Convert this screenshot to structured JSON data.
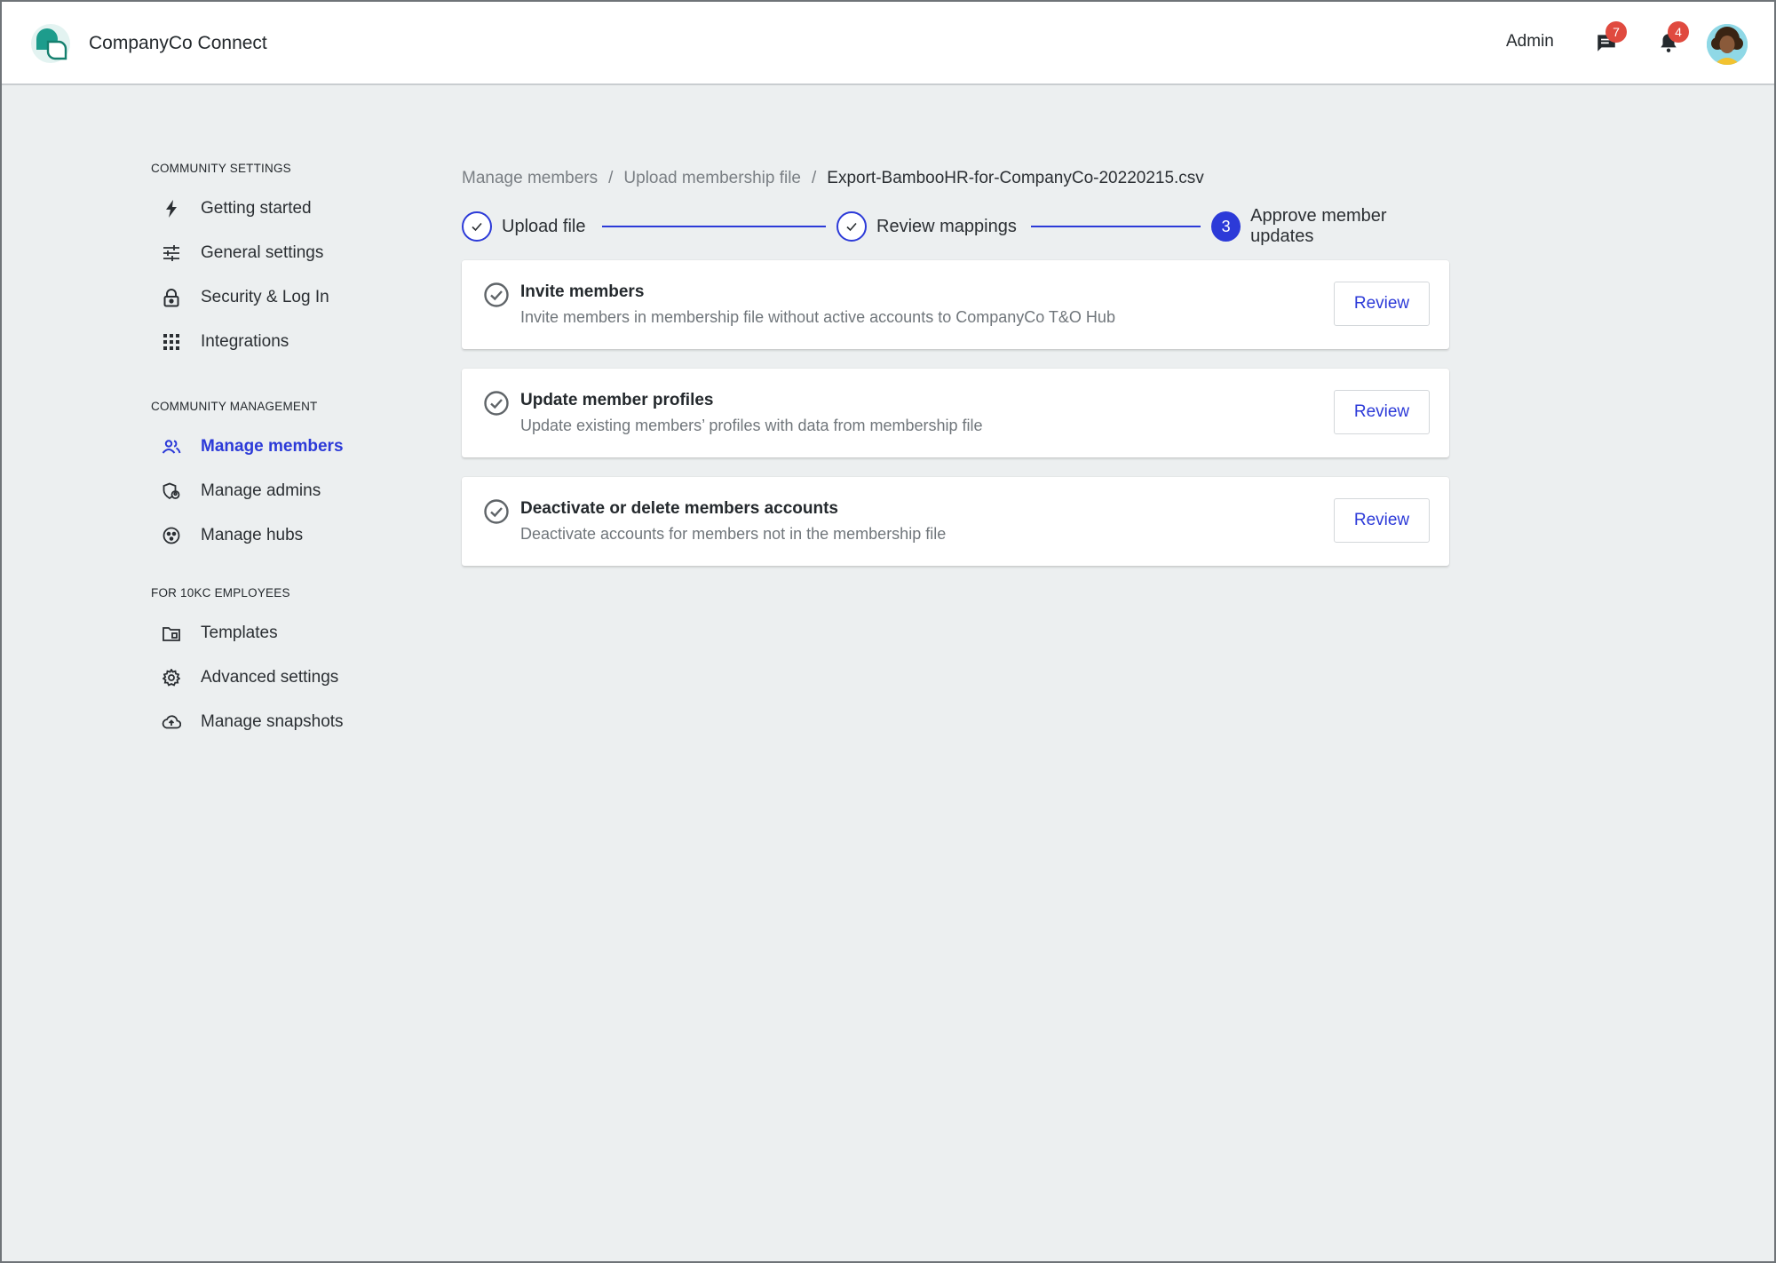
{
  "header": {
    "app_name": "CompanyCo Connect",
    "role_label": "Admin",
    "messages_count": "7",
    "notifications_count": "4",
    "accent_color": "#2c3ad8",
    "badge_color": "#e04a3f"
  },
  "sidebar": {
    "sections": [
      {
        "title": "COMMUNITY SETTINGS",
        "items": [
          {
            "label": "Getting started",
            "icon": "bolt-icon"
          },
          {
            "label": "General settings",
            "icon": "sliders-icon"
          },
          {
            "label": "Security & Log In",
            "icon": "lock-icon"
          },
          {
            "label": "Integrations",
            "icon": "grid-icon"
          }
        ]
      },
      {
        "title": "COMMUNITY MANAGEMENT",
        "items": [
          {
            "label": "Manage members",
            "icon": "people-icon",
            "active": true
          },
          {
            "label": "Manage admins",
            "icon": "admin-shield-icon"
          },
          {
            "label": "Manage hubs",
            "icon": "hub-icon"
          }
        ]
      },
      {
        "title": "FOR 10KC EMPLOYEES",
        "items": [
          {
            "label": "Templates",
            "icon": "folder-icon"
          },
          {
            "label": "Advanced settings",
            "icon": "gear-icon"
          },
          {
            "label": "Manage snapshots",
            "icon": "cloud-upload-icon"
          }
        ]
      }
    ]
  },
  "breadcrumb": {
    "items": [
      "Manage members",
      "Upload membership file",
      "Export-BambooHR-for-CompanyCo-20220215.csv"
    ],
    "separator": "/"
  },
  "stepper": {
    "steps": [
      {
        "label": "Upload file",
        "state": "done"
      },
      {
        "label": "Review mappings",
        "state": "done"
      },
      {
        "label": "Approve member updates",
        "state": "current",
        "number": "3"
      }
    ]
  },
  "cards": [
    {
      "title": "Invite members",
      "description": "Invite members in membership file without active accounts to CompanyCo T&O Hub",
      "button": "Review"
    },
    {
      "title": "Update member profiles",
      "description": "Update existing members’ profiles with data from membership file",
      "button": "Review"
    },
    {
      "title": "Deactivate or delete members accounts",
      "description": "Deactivate accounts for members not in the membership file",
      "button": "Review"
    }
  ]
}
